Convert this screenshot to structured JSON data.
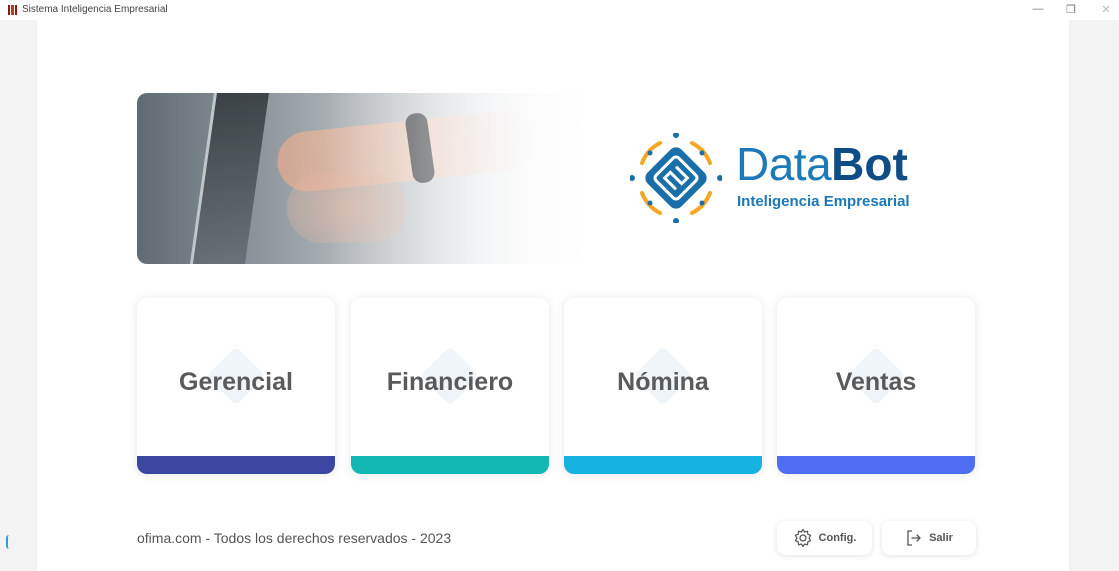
{
  "window": {
    "title": "Sistema Inteligencia Empresarial",
    "controls": [
      "—",
      "❐",
      "✕"
    ]
  },
  "brand": {
    "name_light": "Data",
    "name_bold": "Bot",
    "tagline": "Inteligencia Empresarial",
    "colors": {
      "primary": "#1b6fa8",
      "accent": "#f5a623",
      "dark": "#0e4d86"
    }
  },
  "modules": [
    {
      "label": "Gerencial",
      "color": "#3c47a2"
    },
    {
      "label": "Financiero",
      "color": "#12b8b3"
    },
    {
      "label": "Nómina",
      "color": "#16b3e2"
    },
    {
      "label": "Ventas",
      "color": "#4f6df0"
    }
  ],
  "footer": {
    "copyright": "ofima.com  - Todos los derechos reservados - 2023",
    "config_label": "Config.",
    "exit_label": "Salir"
  }
}
